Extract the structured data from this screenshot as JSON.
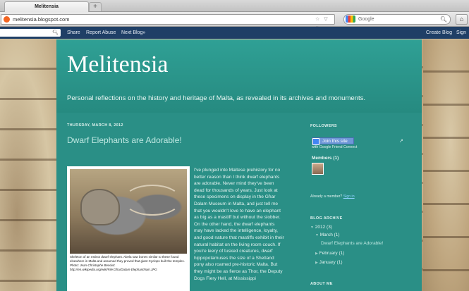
{
  "browser": {
    "tab_title": "Melitensia",
    "new_tab_symbol": "+",
    "url": "melitensia.blogspot.com",
    "url_icons": "☆ ▽ C",
    "search_placeholder": "Google",
    "search_icon": "search-icon",
    "home_icon": "home-icon"
  },
  "blogger_bar": {
    "links": [
      "Share",
      "Report Abuse",
      "Next Blog»"
    ],
    "right_links": [
      "Create Blog",
      "Sign"
    ]
  },
  "blog": {
    "title": "Melitensia",
    "description": "Personal reflections on the history and heritage of Malta, as revealed in its archives and monuments."
  },
  "post": {
    "date": "THURSDAY, MARCH 8, 2012",
    "title": "Dwarf Elephants are Adorable!",
    "caption_1": "Skeleton of an extinct dwarf elephant. Abela saw bones similar to these found elsewhere in Malta and assumed they proved that giant Cyclops built the temples.",
    "caption_2": "Photo: Jean-Christophe Benoist.",
    "caption_3": "http://en.wikipedia.org/wiki/File:GharDalam-ElephantNain.JPG",
    "body": "I've plunged into Maltese prehistory for no better reason than I think dwarf elephants are adorable. Never mind they've been dead for thousands of years. Just look at these specimens on display in the Għar Dalam Museum in Malta, and just tell me that you wouldn't love to have an elephant as big as a mastiff but without the slobber. On the other hand, the dwarf elephants may have lacked the intelligence, loyalty, and good nature that mastiffs exhibit in their natural habitat on the living room couch. If you're leery of tusked creatures, dwarf hippopotamuses the size of a Shetland pony also roamed pre-historic Malta. But they might be as fierce as Thor, the Deputy Dogs Fiery Hell, at Mississippi"
  },
  "sidebar": {
    "followers_title": "FOLLOWERS",
    "join_label": "Join this site",
    "gfc_label": "with Google Friend Connect",
    "members_label": "Members (1)",
    "already_member": "Already a member?",
    "sign_in": "Sign in",
    "archive_title": "BLOG ARCHIVE",
    "archive_year": "2012 (3)",
    "archive_month": "March (1)",
    "archive_post": "Dwarf Elephants are Adorable!",
    "archive_feb": "February (1)",
    "archive_jan": "January (1)",
    "about_title": "ABOUT ME"
  },
  "colors": {
    "main_bg": "#2a8f86",
    "blogger_bar": "#1f3f66",
    "link": "#8fd3ff"
  }
}
